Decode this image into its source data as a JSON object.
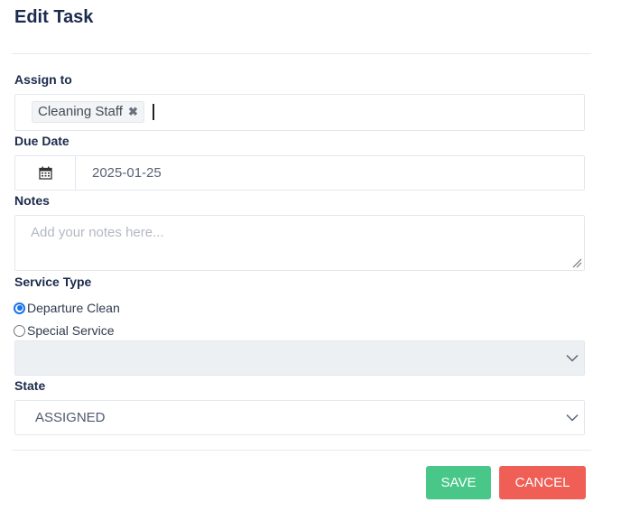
{
  "dialog": {
    "title": "Edit Task"
  },
  "assign_to": {
    "label": "Assign to",
    "chips": [
      {
        "label": "Cleaning Staff",
        "remove_icon": "close-icon"
      }
    ],
    "value": ""
  },
  "due_date": {
    "label": "Due Date",
    "icon": "calendar-icon",
    "value": "2025-01-25"
  },
  "notes": {
    "label": "Notes",
    "placeholder": "Add your notes here...",
    "value": ""
  },
  "service_type": {
    "label": "Service Type",
    "options": [
      {
        "label": "Departure Clean",
        "checked": true
      },
      {
        "label": "Special Service",
        "checked": false
      }
    ],
    "special_service_select": {
      "value": "",
      "disabled": true
    }
  },
  "state": {
    "label": "State",
    "value": "ASSIGNED"
  },
  "actions": {
    "save_label": "SAVE",
    "cancel_label": "CANCEL",
    "save_color": "#48c788",
    "cancel_color": "#ef5f56"
  }
}
